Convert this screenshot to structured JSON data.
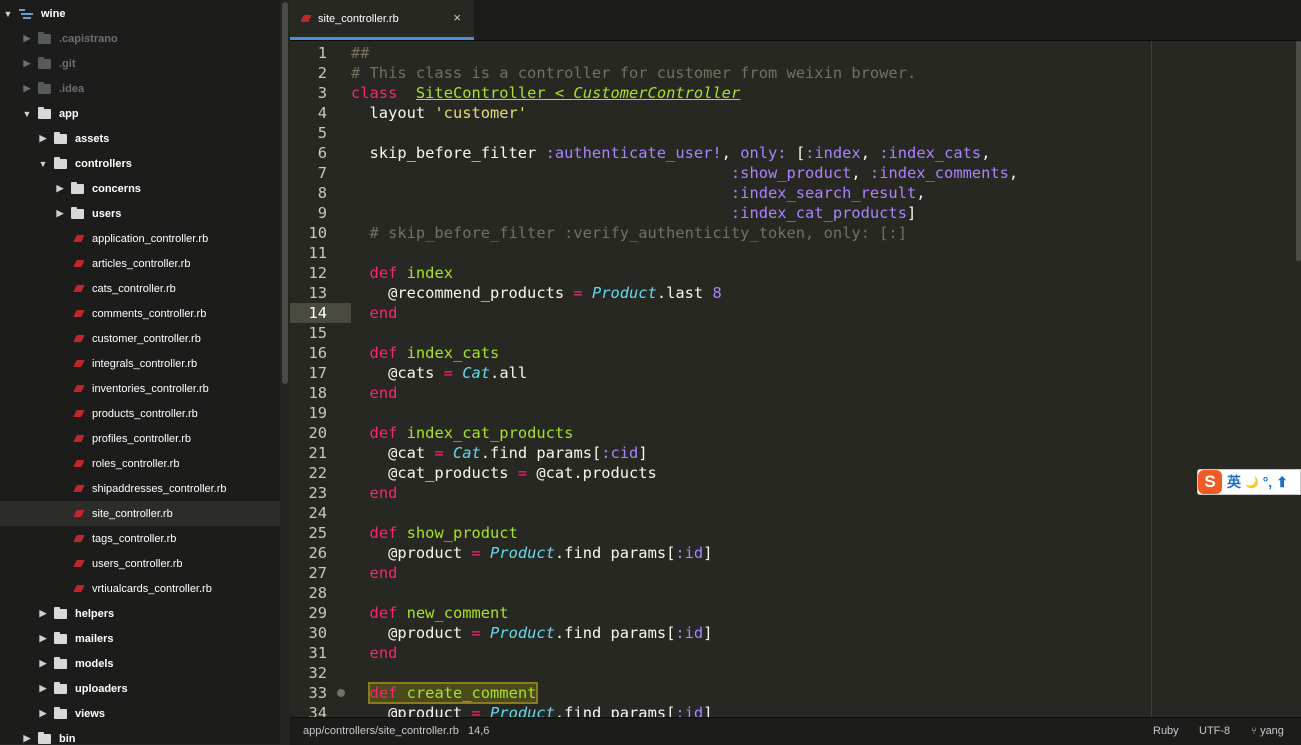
{
  "project": {
    "name": "wine"
  },
  "tree": [
    {
      "label": ".capistrano",
      "type": "folder",
      "depth": 1,
      "expanded": false,
      "dim": true
    },
    {
      "label": ".git",
      "type": "folder",
      "depth": 1,
      "expanded": false,
      "dim": true
    },
    {
      "label": ".idea",
      "type": "folder",
      "depth": 1,
      "expanded": false,
      "dim": true
    },
    {
      "label": "app",
      "type": "folder",
      "depth": 1,
      "expanded": true
    },
    {
      "label": "assets",
      "type": "folder",
      "depth": 2,
      "expanded": false
    },
    {
      "label": "controllers",
      "type": "folder",
      "depth": 2,
      "expanded": true
    },
    {
      "label": "concerns",
      "type": "folder",
      "depth": 3,
      "expanded": false
    },
    {
      "label": "users",
      "type": "folder",
      "depth": 3,
      "expanded": false
    },
    {
      "label": "application_controller.rb",
      "type": "file",
      "depth": 3
    },
    {
      "label": "articles_controller.rb",
      "type": "file",
      "depth": 3
    },
    {
      "label": "cats_controller.rb",
      "type": "file",
      "depth": 3
    },
    {
      "label": "comments_controller.rb",
      "type": "file",
      "depth": 3
    },
    {
      "label": "customer_controller.rb",
      "type": "file",
      "depth": 3
    },
    {
      "label": "integrals_controller.rb",
      "type": "file",
      "depth": 3
    },
    {
      "label": "inventories_controller.rb",
      "type": "file",
      "depth": 3
    },
    {
      "label": "products_controller.rb",
      "type": "file",
      "depth": 3
    },
    {
      "label": "profiles_controller.rb",
      "type": "file",
      "depth": 3
    },
    {
      "label": "roles_controller.rb",
      "type": "file",
      "depth": 3
    },
    {
      "label": "shipaddresses_controller.rb",
      "type": "file",
      "depth": 3
    },
    {
      "label": "site_controller.rb",
      "type": "file",
      "depth": 3,
      "selected": true
    },
    {
      "label": "tags_controller.rb",
      "type": "file",
      "depth": 3
    },
    {
      "label": "users_controller.rb",
      "type": "file",
      "depth": 3
    },
    {
      "label": "vrtiualcards_controller.rb",
      "type": "file",
      "depth": 3
    },
    {
      "label": "helpers",
      "type": "folder",
      "depth": 2,
      "expanded": false
    },
    {
      "label": "mailers",
      "type": "folder",
      "depth": 2,
      "expanded": false
    },
    {
      "label": "models",
      "type": "folder",
      "depth": 2,
      "expanded": false
    },
    {
      "label": "uploaders",
      "type": "folder",
      "depth": 2,
      "expanded": false
    },
    {
      "label": "views",
      "type": "folder",
      "depth": 2,
      "expanded": false
    },
    {
      "label": "bin",
      "type": "folder",
      "depth": 1,
      "expanded": false
    }
  ],
  "tab": {
    "title": "site_controller.rb",
    "close": "×"
  },
  "editor": {
    "current_line": 14,
    "lines": [
      [
        [
          "com",
          "##"
        ]
      ],
      [
        [
          "com",
          "# This class is a controller for customer from weixin brower."
        ]
      ],
      [
        [
          "kw",
          "class"
        ],
        [
          "",
          "  "
        ],
        [
          "inh",
          "SiteController < "
        ],
        [
          "inhi",
          "CustomerController"
        ]
      ],
      [
        [
          "",
          "  layout "
        ],
        [
          "str",
          "'customer'"
        ]
      ],
      [],
      [
        [
          "",
          "  skip_before_filter "
        ],
        [
          "sym",
          ":authenticate_user!"
        ],
        [
          "",
          ", "
        ],
        [
          "sym",
          "only:"
        ],
        [
          "",
          " ["
        ],
        [
          "sym",
          ":index"
        ],
        [
          "",
          ", "
        ],
        [
          "sym",
          ":index_cats"
        ],
        [
          "",
          ","
        ]
      ],
      [
        [
          "",
          "                                         "
        ],
        [
          "sym",
          ":show_product"
        ],
        [
          "",
          ", "
        ],
        [
          "sym",
          ":index_comments"
        ],
        [
          "",
          ","
        ]
      ],
      [
        [
          "",
          "                                         "
        ],
        [
          "sym",
          ":index_search_result"
        ],
        [
          "",
          ","
        ]
      ],
      [
        [
          "",
          "                                         "
        ],
        [
          "sym",
          ":index_cat_products"
        ],
        [
          "",
          "]"
        ]
      ],
      [
        [
          "com",
          "  # skip_before_filter :verify_authenticity_token, only: [:]"
        ]
      ],
      [],
      [
        [
          "",
          "  "
        ],
        [
          "kw",
          "def"
        ],
        [
          "",
          " "
        ],
        [
          "fn",
          "index"
        ]
      ],
      [
        [
          "",
          "    @recommend_products "
        ],
        [
          "op",
          "="
        ],
        [
          "",
          " "
        ],
        [
          "cls",
          "Product"
        ],
        [
          "",
          ".last "
        ],
        [
          "num",
          "8"
        ]
      ],
      [
        [
          "",
          "  "
        ],
        [
          "kw",
          "end"
        ]
      ],
      [],
      [
        [
          "",
          "  "
        ],
        [
          "kw",
          "def"
        ],
        [
          "",
          " "
        ],
        [
          "fn",
          "index_cats"
        ]
      ],
      [
        [
          "",
          "    @cats "
        ],
        [
          "op",
          "="
        ],
        [
          "",
          " "
        ],
        [
          "cls",
          "Cat"
        ],
        [
          "",
          ".all"
        ]
      ],
      [
        [
          "",
          "  "
        ],
        [
          "kw",
          "end"
        ]
      ],
      [],
      [
        [
          "",
          "  "
        ],
        [
          "kw",
          "def"
        ],
        [
          "",
          " "
        ],
        [
          "fn",
          "index_cat_products"
        ]
      ],
      [
        [
          "",
          "    @cat "
        ],
        [
          "op",
          "="
        ],
        [
          "",
          " "
        ],
        [
          "cls",
          "Cat"
        ],
        [
          "",
          ".find params["
        ],
        [
          "sym",
          ":cid"
        ],
        [
          "",
          "]"
        ]
      ],
      [
        [
          "",
          "    @cat_products "
        ],
        [
          "op",
          "="
        ],
        [
          "",
          " @cat.products"
        ]
      ],
      [
        [
          "",
          "  "
        ],
        [
          "kw",
          "end"
        ]
      ],
      [],
      [
        [
          "",
          "  "
        ],
        [
          "kw",
          "def"
        ],
        [
          "",
          " "
        ],
        [
          "fn",
          "show_product"
        ]
      ],
      [
        [
          "",
          "    @product "
        ],
        [
          "op",
          "="
        ],
        [
          "",
          " "
        ],
        [
          "cls",
          "Product"
        ],
        [
          "",
          ".find params["
        ],
        [
          "sym",
          ":id"
        ],
        [
          "",
          "]"
        ]
      ],
      [
        [
          "",
          "  "
        ],
        [
          "kw",
          "end"
        ]
      ],
      [],
      [
        [
          "",
          "  "
        ],
        [
          "kw",
          "def"
        ],
        [
          "",
          " "
        ],
        [
          "fn",
          "new_comment"
        ]
      ],
      [
        [
          "",
          "    @product "
        ],
        [
          "op",
          "="
        ],
        [
          "",
          " "
        ],
        [
          "cls",
          "Product"
        ],
        [
          "",
          ".find params["
        ],
        [
          "sym",
          ":id"
        ],
        [
          "",
          "]"
        ]
      ],
      [
        [
          "",
          "  "
        ],
        [
          "kw",
          "end"
        ]
      ],
      [],
      [
        [
          "",
          "  "
        ],
        [
          "hlkw",
          "def"
        ],
        [
          "hl",
          " "
        ],
        [
          "hlfn",
          "create_comment"
        ]
      ],
      [
        [
          "",
          "    @product "
        ],
        [
          "op",
          "="
        ],
        [
          "",
          " "
        ],
        [
          "cls",
          "Product"
        ],
        [
          "",
          ".find params["
        ],
        [
          "sym",
          ":id"
        ],
        [
          "",
          "]"
        ]
      ]
    ]
  },
  "ime": {
    "logo": "S",
    "lang": "英",
    "moon": "🌙",
    "punct": "°,",
    "extra": "⬆"
  },
  "status": {
    "path": "app/controllers/site_controller.rb",
    "cursor": "14,6",
    "grammar": "Ruby",
    "encoding": "UTF-8",
    "user": "yang"
  }
}
